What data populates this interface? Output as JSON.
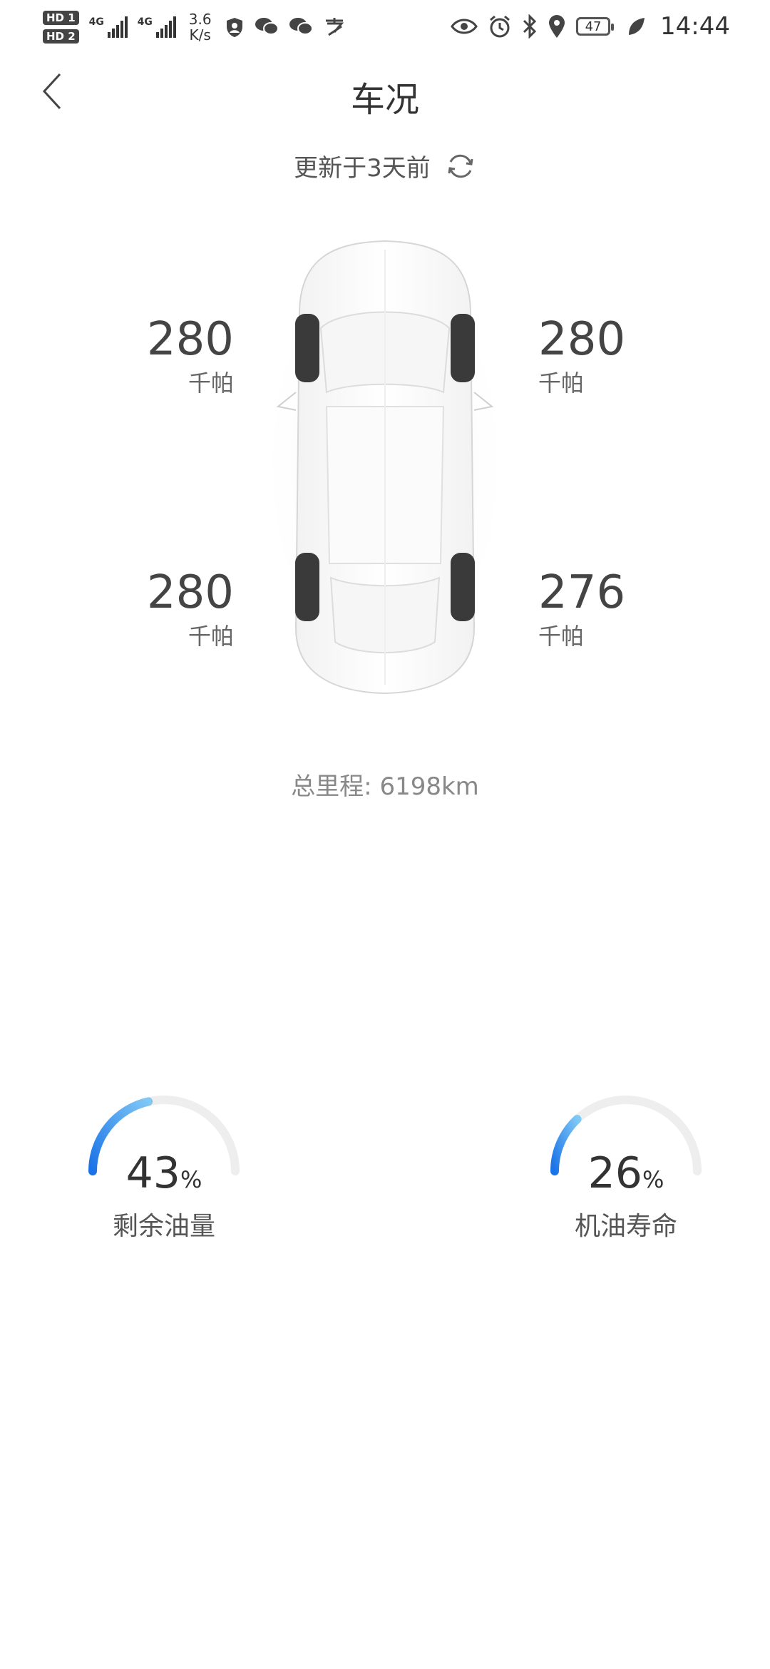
{
  "status_bar": {
    "hd1": "HD 1",
    "hd2": "HD 2",
    "net1": "4G",
    "net2": "4G",
    "speed_value": "3.6",
    "speed_unit": "K/s",
    "battery": "47",
    "time": "14:44"
  },
  "header": {
    "title": "车况"
  },
  "update": {
    "text": "更新于3天前"
  },
  "tires": {
    "front_left": {
      "value": "280",
      "unit": "千帕"
    },
    "front_right": {
      "value": "280",
      "unit": "千帕"
    },
    "rear_left": {
      "value": "280",
      "unit": "千帕"
    },
    "rear_right": {
      "value": "276",
      "unit": "千帕"
    }
  },
  "mileage": {
    "text": "总里程: 6198km"
  },
  "gauges": {
    "fuel": {
      "percent": 43,
      "value": "43",
      "symbol": "%",
      "label": "剩余油量"
    },
    "oil": {
      "percent": 26,
      "value": "26",
      "symbol": "%",
      "label": "机油寿命"
    }
  },
  "colors": {
    "gauge_track": "#eeeeee",
    "gauge_start": "#1a73e8",
    "gauge_end": "#7ec8f5"
  }
}
